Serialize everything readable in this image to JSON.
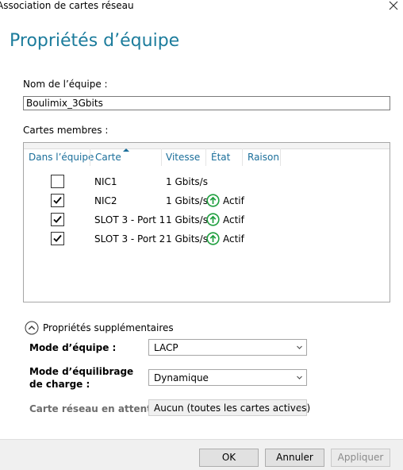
{
  "window": {
    "title": "Association de cartes réseau"
  },
  "heading": "Propriétés d’équipe",
  "team_name": {
    "label": "Nom de l’équipe :",
    "value": "Boulimix_3Gbits"
  },
  "members": {
    "label": "Cartes membres :",
    "columns": [
      "Dans l’équipe",
      "Carte",
      "Vitesse",
      "État",
      "Raison"
    ],
    "sorted_column": "Carte",
    "rows": [
      {
        "in_team": false,
        "adapter": "NIC1",
        "speed": "1 Gbits/s",
        "state": ""
      },
      {
        "in_team": true,
        "adapter": "NIC2",
        "speed": "1 Gbits/s",
        "state": "Actif"
      },
      {
        "in_team": true,
        "adapter": "SLOT 3 - Port 1",
        "speed": "1 Gbits/s",
        "state": "Actif"
      },
      {
        "in_team": true,
        "adapter": "SLOT 3 - Port 2",
        "speed": "1 Gbits/s",
        "state": "Actif"
      }
    ]
  },
  "additional": {
    "toggle_label": "Propriétés supplémentaires",
    "expanded": true,
    "teaming_mode": {
      "label": "Mode d’équipe :",
      "value": "LACP"
    },
    "load_balancing": {
      "label": "Mode d’équilibrage de charge :",
      "value": "Dynamique"
    },
    "standby": {
      "label": "Carte réseau en attente :",
      "value": "Aucun (toutes les cartes actives)",
      "disabled": true
    }
  },
  "buttons": {
    "ok": "OK",
    "cancel": "Annuler",
    "apply": "Appliquer"
  },
  "colors": {
    "accent": "#1c7c9c",
    "header_text": "#1a6e9a",
    "status_green": "#1e9e3e"
  }
}
